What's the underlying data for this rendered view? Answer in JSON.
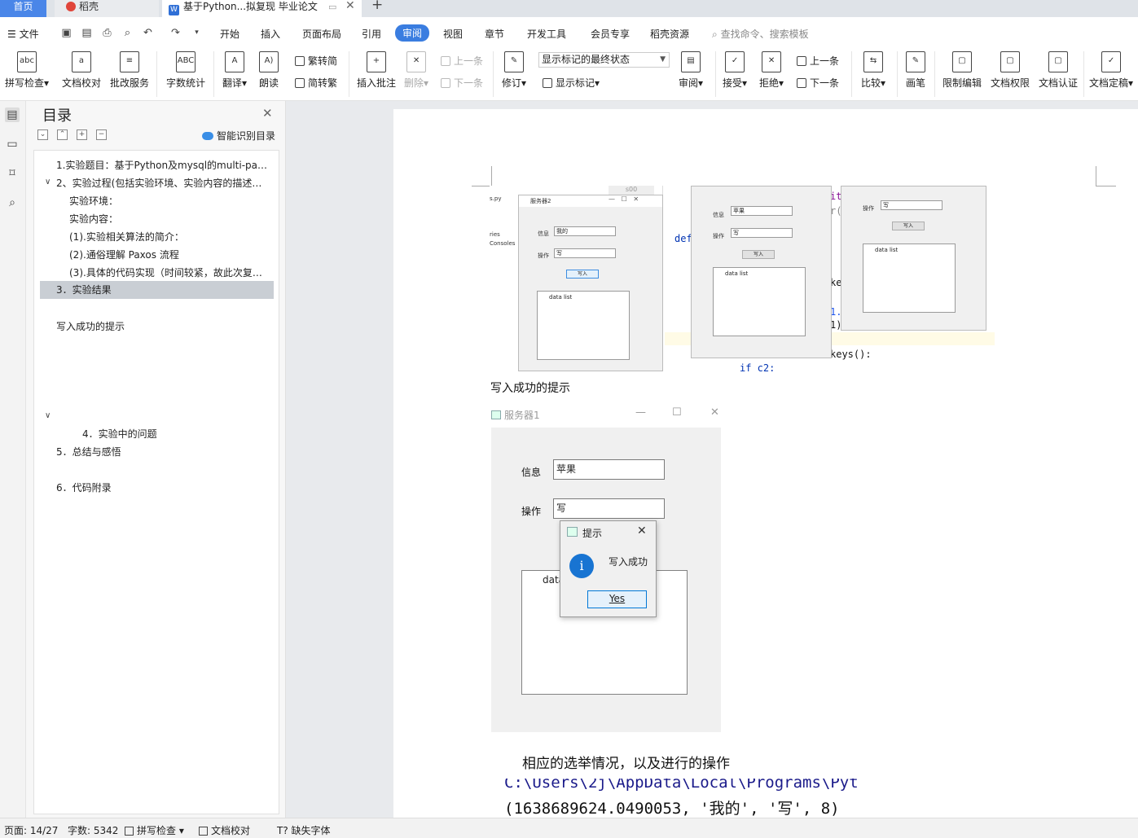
{
  "tabs": {
    "home": "首页",
    "shell": "稻壳",
    "doc": "基于Python...拟复现 毕业论文"
  },
  "menu": {
    "file": "文件",
    "items": [
      "开始",
      "插入",
      "页面布局",
      "引用",
      "审阅",
      "视图",
      "章节",
      "开发工具",
      "会员专享",
      "稻壳资源"
    ],
    "active": "审阅",
    "search_placeholder": "查找命令、搜索模板"
  },
  "ribbon": {
    "spell_check": "拼写检查",
    "doc_proof": "文档校对",
    "revise_service": "批改服务",
    "word_count": "字数统计",
    "translate": "翻译",
    "read_aloud": "朗读",
    "to_simplified": "繁转简",
    "to_traditional": "简转繁",
    "insert_comment": "插入批注",
    "delete": "删除",
    "prev_comment": "上一条",
    "next_comment": "下一条",
    "track_changes": "修订",
    "markup_state": "显示标记的最终状态",
    "show_markup": "显示标记",
    "review": "审阅",
    "accept": "接受",
    "reject": "拒绝",
    "prev_change": "上一条",
    "next_change": "下一条",
    "compare": "比较",
    "ink": "画笔",
    "restrict_edit": "限制编辑",
    "doc_permission": "文档权限",
    "doc_certify": "文档认证",
    "doc_finalize": "文档定稿"
  },
  "toc": {
    "title": "目录",
    "smart_label": "智能识别目录",
    "items": [
      "1.实验题目：基于Python及mysql的multi-paxos...",
      "2、实验过程(包括实验环境、实验内容的描述、...",
      "实验环境：",
      "实验内容：",
      "(1).实验相关算法的简介：",
      "(2).通俗理解 Paxos 流程",
      "(3).具体的代码实现（时间较紧，故此次复现...",
      "3．实验结果",
      "写入成功的提示",
      "4．实验中的问题",
      "5．总结与感悟",
      "6．代码附录"
    ]
  },
  "doc": {
    "mini_top": {
      "file_label": "s.py",
      "tree_label1": "ries",
      "tree_label2": "Consoles",
      "win_title": "服务器2",
      "info_label": "信息",
      "info_value": "我的",
      "op_label": "操作",
      "op_value": "写",
      "write_btn": "写入",
      "list_header": "data list",
      "code_def": "def",
      "code_it": "it",
      "code_r": "r(",
      "code_ke": "ke",
      "code_1dot": "1.",
      "code_1paren": "1)",
      "code_keys": "keys():",
      "code_ifc2": "if c2:",
      "tab_label": "s00",
      "win2_info_label": "信息",
      "win2_info_value": "苹果",
      "win2_op_label": "操作",
      "win2_op_value": "写",
      "win2_btn": "写入",
      "win2_list": "data list",
      "win3_op_label": "操作",
      "win3_op_value": "写",
      "win3_btn": "写入",
      "win3_list": "data list"
    },
    "caption": "写入成功的提示",
    "server1": {
      "title": "服务器1",
      "info_label": "信息",
      "info_value": "苹果",
      "op_label": "操作",
      "op_value": "写",
      "list_header": "data list"
    },
    "dialog": {
      "title": "提示",
      "message": "写入成功",
      "yes": "Yes"
    },
    "paragraph": "相应的选举情况，以及进行的操作",
    "code_line1": "C:\\Users\\2j\\AppData\\Local\\Programs\\Pyt",
    "code_line2": "(1638689624.0490053, '我的', '写', 8)"
  },
  "status": {
    "page": "页面: 14/27",
    "words": "字数: 5342",
    "spell": "拼写检查",
    "proof": "文档校对",
    "missing_font": "缺失字体"
  }
}
